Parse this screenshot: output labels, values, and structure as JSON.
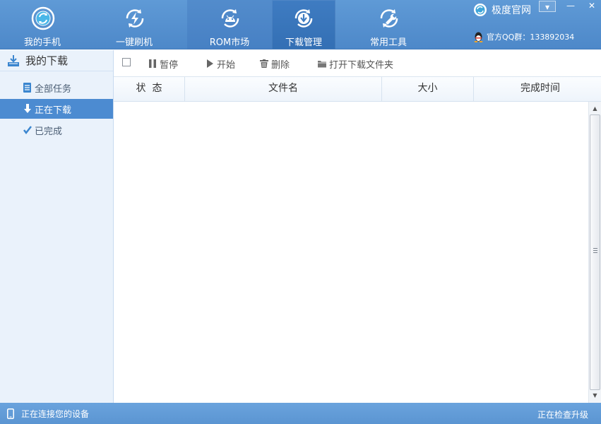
{
  "nav": {
    "items": [
      {
        "label": "我的手机",
        "icon": "phone-sync-icon"
      },
      {
        "label": "一键刷机",
        "icon": "lightning-icon"
      },
      {
        "label": "ROM市场",
        "icon": "android-icon"
      },
      {
        "label": "下载管理",
        "icon": "download-icon"
      },
      {
        "label": "常用工具",
        "icon": "wrench-icon"
      }
    ],
    "active_index": 3
  },
  "brand": {
    "text": "极度官网",
    "icon": "brand-logo-icon"
  },
  "qq": {
    "text": "官方QQ群：133892034",
    "icon": "qq-penguin-icon"
  },
  "window_controls": {
    "menu": "▾",
    "minimize": "—",
    "close": "✕"
  },
  "sidebar": {
    "title": "我的下载",
    "items": [
      {
        "label": "全部任务",
        "icon": "list-icon"
      },
      {
        "label": "正在下载",
        "icon": "arrow-down-icon"
      },
      {
        "label": "已完成",
        "icon": "checkmark-icon"
      }
    ],
    "active_index": 1
  },
  "toolbar": {
    "pause_label": "暂停",
    "start_label": "开始",
    "delete_label": "删除",
    "open_folder_label": "打开下载文件夹"
  },
  "table": {
    "columns": [
      "状  态",
      "文件名",
      "大小",
      "完成时间"
    ],
    "rows": []
  },
  "statusbar": {
    "left_text": "正在连接您的设备",
    "right_text": "正在检查升级"
  },
  "colors": {
    "header_blue": "#4d88c9",
    "active_nav": "#336fb4",
    "sidebar_bg": "#eaf2fb",
    "sidebar_active": "#4c8bd1",
    "statusbar_blue": "#5b95d2"
  }
}
